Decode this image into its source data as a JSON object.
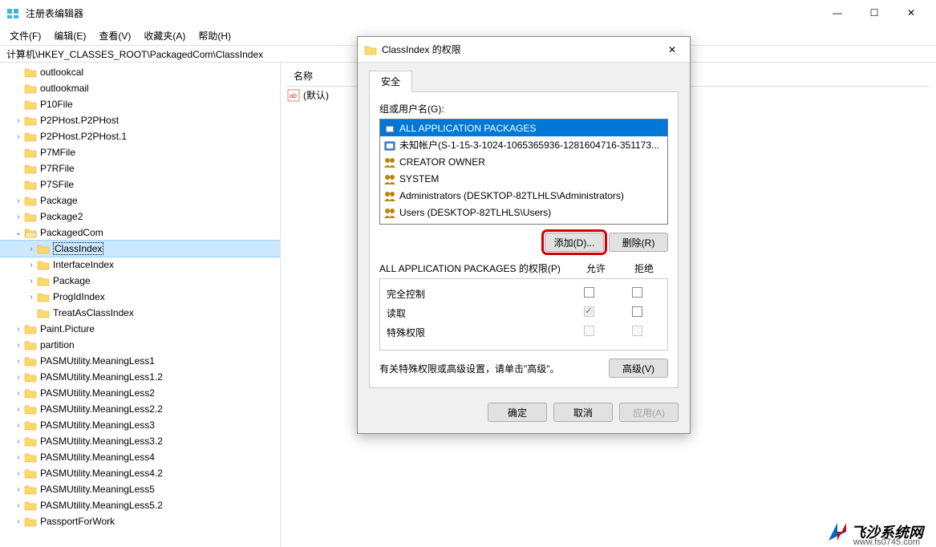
{
  "window": {
    "title": "注册表编辑器",
    "minimize": "—",
    "maximize": "☐",
    "close": "✕"
  },
  "menu": {
    "file": "文件(F)",
    "edit": "编辑(E)",
    "view": "查看(V)",
    "favorites": "收藏夹(A)",
    "help": "帮助(H)"
  },
  "path": "计算机\\HKEY_CLASSES_ROOT\\PackagedCom\\ClassIndex",
  "tree": [
    {
      "depth": 1,
      "exp": "",
      "label": "outlookcal"
    },
    {
      "depth": 1,
      "exp": "",
      "label": "outlookmail"
    },
    {
      "depth": 1,
      "exp": "",
      "label": "P10File"
    },
    {
      "depth": 1,
      "exp": ">",
      "label": "P2PHost.P2PHost"
    },
    {
      "depth": 1,
      "exp": ">",
      "label": "P2PHost.P2PHost.1"
    },
    {
      "depth": 1,
      "exp": "",
      "label": "P7MFile"
    },
    {
      "depth": 1,
      "exp": "",
      "label": "P7RFile"
    },
    {
      "depth": 1,
      "exp": "",
      "label": "P7SFile"
    },
    {
      "depth": 1,
      "exp": ">",
      "label": "Package"
    },
    {
      "depth": 1,
      "exp": ">",
      "label": "Package2"
    },
    {
      "depth": 1,
      "exp": "v",
      "label": "PackagedCom"
    },
    {
      "depth": 2,
      "exp": ">",
      "label": "ClassIndex",
      "selected": true
    },
    {
      "depth": 2,
      "exp": ">",
      "label": "InterfaceIndex"
    },
    {
      "depth": 2,
      "exp": ">",
      "label": "Package"
    },
    {
      "depth": 2,
      "exp": ">",
      "label": "ProgIdIndex"
    },
    {
      "depth": 2,
      "exp": "",
      "label": "TreatAsClassIndex"
    },
    {
      "depth": 1,
      "exp": ">",
      "label": "Paint.Picture"
    },
    {
      "depth": 1,
      "exp": ">",
      "label": "partition"
    },
    {
      "depth": 1,
      "exp": ">",
      "label": "PASMUtility.MeaningLess1"
    },
    {
      "depth": 1,
      "exp": ">",
      "label": "PASMUtility.MeaningLess1.2"
    },
    {
      "depth": 1,
      "exp": ">",
      "label": "PASMUtility.MeaningLess2"
    },
    {
      "depth": 1,
      "exp": ">",
      "label": "PASMUtility.MeaningLess2.2"
    },
    {
      "depth": 1,
      "exp": ">",
      "label": "PASMUtility.MeaningLess3"
    },
    {
      "depth": 1,
      "exp": ">",
      "label": "PASMUtility.MeaningLess3.2"
    },
    {
      "depth": 1,
      "exp": ">",
      "label": "PASMUtility.MeaningLess4"
    },
    {
      "depth": 1,
      "exp": ">",
      "label": "PASMUtility.MeaningLess4.2"
    },
    {
      "depth": 1,
      "exp": ">",
      "label": "PASMUtility.MeaningLess5"
    },
    {
      "depth": 1,
      "exp": ">",
      "label": "PASMUtility.MeaningLess5.2"
    },
    {
      "depth": 1,
      "exp": ">",
      "label": "PassportForWork"
    }
  ],
  "list": {
    "header_name": "名称",
    "default_value": "(默认)"
  },
  "dialog": {
    "title": "ClassIndex 的权限",
    "tab_security": "安全",
    "group_label": "组或用户名(G):",
    "users": [
      {
        "label": "ALL APPLICATION PACKAGES",
        "selected": true,
        "icon": "pkg"
      },
      {
        "label": "未知帐户(S-1-15-3-1024-1065365936-1281604716-351173...",
        "icon": "pkg"
      },
      {
        "label": "CREATOR OWNER",
        "icon": "grp"
      },
      {
        "label": "SYSTEM",
        "icon": "grp"
      },
      {
        "label": "Administrators (DESKTOP-82TLHLS\\Administrators)",
        "icon": "grp"
      },
      {
        "label": "Users (DESKTOP-82TLHLS\\Users)",
        "icon": "grp"
      }
    ],
    "btn_add": "添加(D)...",
    "btn_remove": "删除(R)",
    "perm_title": "ALL APPLICATION PACKAGES 的权限(P)",
    "col_allow": "允许",
    "col_deny": "拒绝",
    "perms": [
      {
        "name": "完全控制",
        "allow": false,
        "deny": false,
        "allowEnabled": true,
        "denyEnabled": true
      },
      {
        "name": "读取",
        "allow": true,
        "deny": false,
        "allowEnabled": false,
        "denyEnabled": true
      },
      {
        "name": "特殊权限",
        "allow": false,
        "deny": false,
        "allowEnabled": false,
        "denyEnabled": false
      }
    ],
    "adv_hint": "有关特殊权限或高级设置，请单击\"高级\"。",
    "btn_advanced": "高级(V)",
    "btn_ok": "确定",
    "btn_cancel": "取消",
    "btn_apply": "应用(A)"
  },
  "watermark": {
    "text": "飞沙系统网",
    "url": "www.fs0745.com"
  }
}
